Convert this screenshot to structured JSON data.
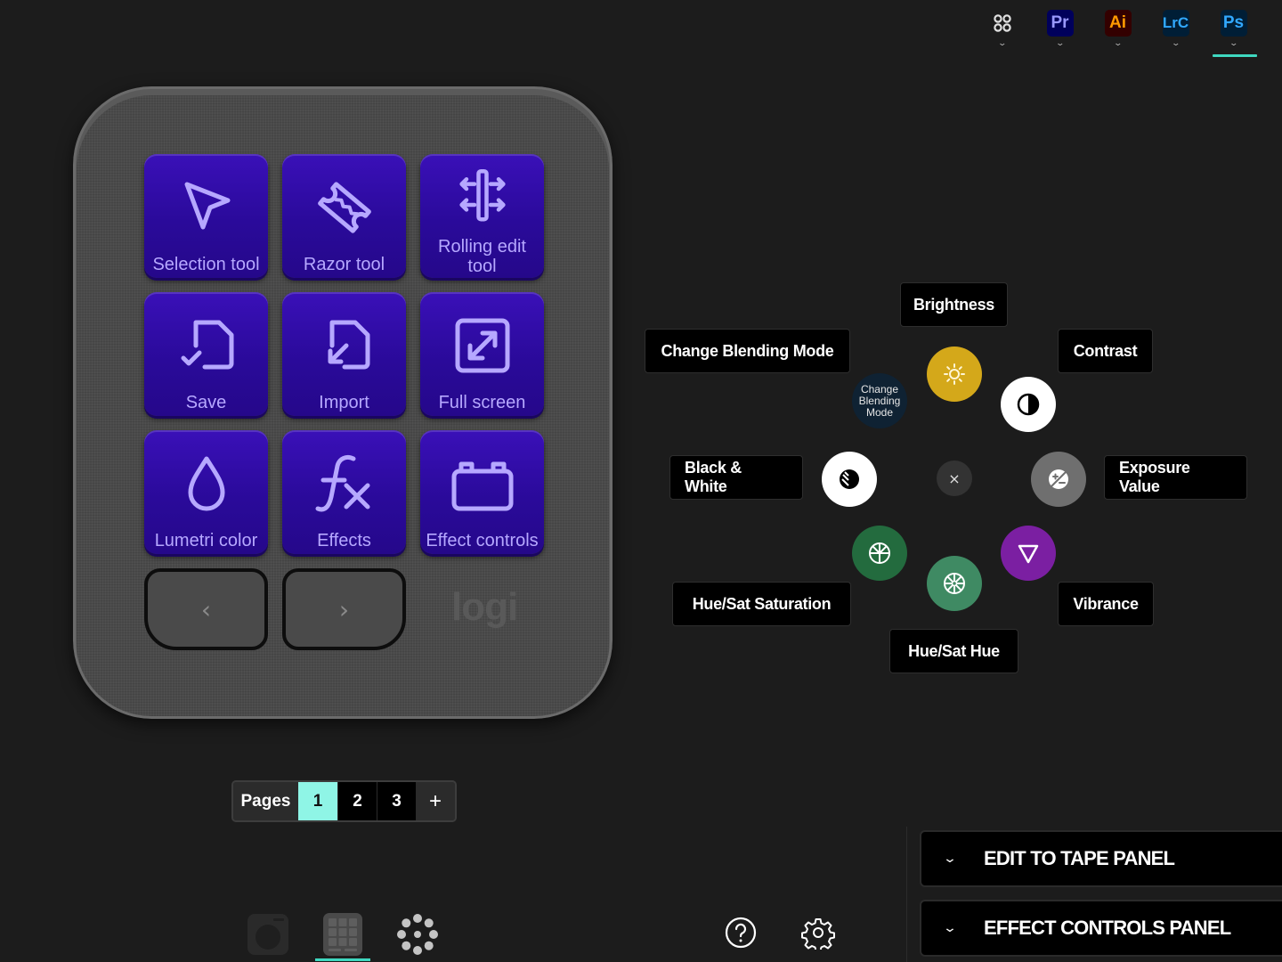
{
  "app_bar": {
    "apps": [
      {
        "id": "all",
        "label": "",
        "icon": "all-apps-icon",
        "active": false
      },
      {
        "id": "pr",
        "label": "Pr",
        "bg": "#00005b",
        "fg": "#9999ff",
        "active": false
      },
      {
        "id": "ai",
        "label": "Ai",
        "bg": "#330000",
        "fg": "#ff9a00",
        "active": false
      },
      {
        "id": "lrc",
        "label": "LrC",
        "bg": "#001e36",
        "fg": "#31a8ff",
        "active": false
      },
      {
        "id": "ps",
        "label": "Ps",
        "bg": "#001e36",
        "fg": "#31a8ff",
        "active": true
      }
    ],
    "active_indicator_color": "#3fd8c0"
  },
  "device": {
    "brand": "logi",
    "keys": [
      {
        "label": "Selection tool",
        "icon": "cursor-arrow-icon"
      },
      {
        "label": "Razor tool",
        "icon": "razor-blade-icon"
      },
      {
        "label": "Rolling edit tool",
        "label_lines": [
          "Rolling edit",
          "tool"
        ],
        "icon": "rolling-edit-icon"
      },
      {
        "label": "Save",
        "icon": "save-file-icon"
      },
      {
        "label": "Import",
        "icon": "import-file-icon"
      },
      {
        "label": "Full screen",
        "icon": "full-screen-icon"
      },
      {
        "label": "Lumetri color",
        "icon": "droplet-icon"
      },
      {
        "label": "Effects",
        "icon": "fx-icon"
      },
      {
        "label": "Effect controls",
        "icon": "effect-controls-icon"
      }
    ],
    "nav_prev": "‹",
    "nav_next": "›",
    "key_color": "#2f0da8",
    "key_text_color": "#b6a8ff"
  },
  "radial_menu": {
    "center_close": "×",
    "actions": [
      {
        "id": "brightness",
        "label": "Brightness",
        "color": "#d4a81a",
        "icon": "sun-icon"
      },
      {
        "id": "contrast",
        "label": "Contrast",
        "color": "#ffffff",
        "icon": "contrast-icon"
      },
      {
        "id": "exposure",
        "label": "Exposure Value",
        "color": "#6f6f6f",
        "icon": "exposure-icon"
      },
      {
        "id": "vibrance",
        "label": "Vibrance",
        "color": "#7b1fa2",
        "icon": "triangle-down-icon"
      },
      {
        "id": "huesat-hue",
        "label": "Hue/Sat Hue",
        "color": "#3f8a63",
        "icon": "color-wheel-icon"
      },
      {
        "id": "huesat-sat",
        "label": "Hue/Sat Saturation",
        "color": "#236b3e",
        "icon": "color-wheel-split-icon"
      },
      {
        "id": "bw",
        "label": "Black & White",
        "color": "#ffffff",
        "icon": "black-white-icon"
      },
      {
        "id": "blend",
        "label": "Change Blending Mode",
        "bubble_text_lines": [
          "Change",
          "Blending",
          "Mode"
        ],
        "color": "#0f2233",
        "icon": ""
      }
    ]
  },
  "pages": {
    "label": "Pages",
    "items": [
      "1",
      "2",
      "3"
    ],
    "active": "1",
    "add_label": "+",
    "active_color": "#8ff5e6"
  },
  "bottom_nav": {
    "items": [
      {
        "id": "dial-device",
        "icon": "dial-device-icon",
        "active": false
      },
      {
        "id": "keypad-device",
        "icon": "keypad-grid-icon",
        "active": true
      },
      {
        "id": "radial-actions",
        "icon": "actions-ring-icon",
        "active": false
      }
    ]
  },
  "utility": {
    "help_icon": "help-icon",
    "settings_icon": "gear-icon"
  },
  "panels": [
    {
      "title": "EDIT TO TAPE PANEL",
      "expanded": false
    },
    {
      "title": "EFFECT CONTROLS PANEL",
      "expanded": false
    }
  ]
}
